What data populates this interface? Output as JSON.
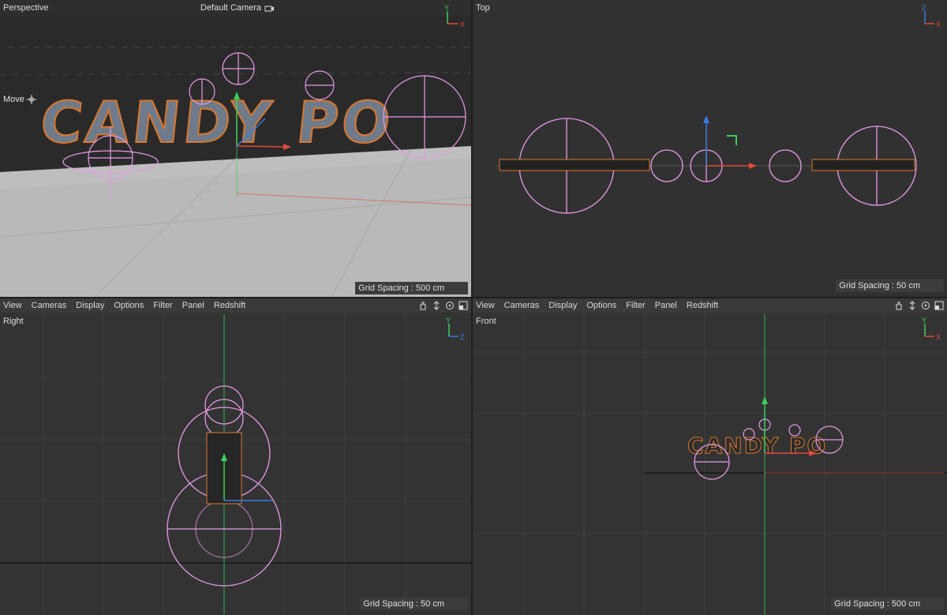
{
  "viewports": {
    "perspective": {
      "title": "Perspective",
      "camera_label": "Default Camera",
      "tool_label": "Move",
      "grid_spacing": "Grid Spacing : 500 cm",
      "scene_text": "CANDY POP"
    },
    "top": {
      "title": "Top",
      "grid_spacing": "Grid Spacing : 50 cm"
    },
    "right": {
      "title": "Right",
      "grid_spacing": "Grid Spacing : 50 cm",
      "menu": [
        "View",
        "Cameras",
        "Display",
        "Options",
        "Filter",
        "Panel",
        "Redshift"
      ]
    },
    "front": {
      "title": "Front",
      "grid_spacing": "Grid Spacing : 500 cm",
      "menu": [
        "View",
        "Cameras",
        "Display",
        "Options",
        "Filter",
        "Panel",
        "Redshift"
      ],
      "scene_text": "CANDY PO"
    }
  },
  "nav_icons": [
    "pan-icon",
    "dolly-icon",
    "rotate-icon",
    "maximize-icon"
  ],
  "axis_letters": {
    "y": "Y",
    "x": "X",
    "z": "Z"
  },
  "colors": {
    "x_axis": "#e04a3c",
    "y_axis": "#3ccf5c",
    "z_axis": "#3a7be0",
    "gizmo_pink": "#e59be6",
    "letter_outline": "#d9772e"
  }
}
